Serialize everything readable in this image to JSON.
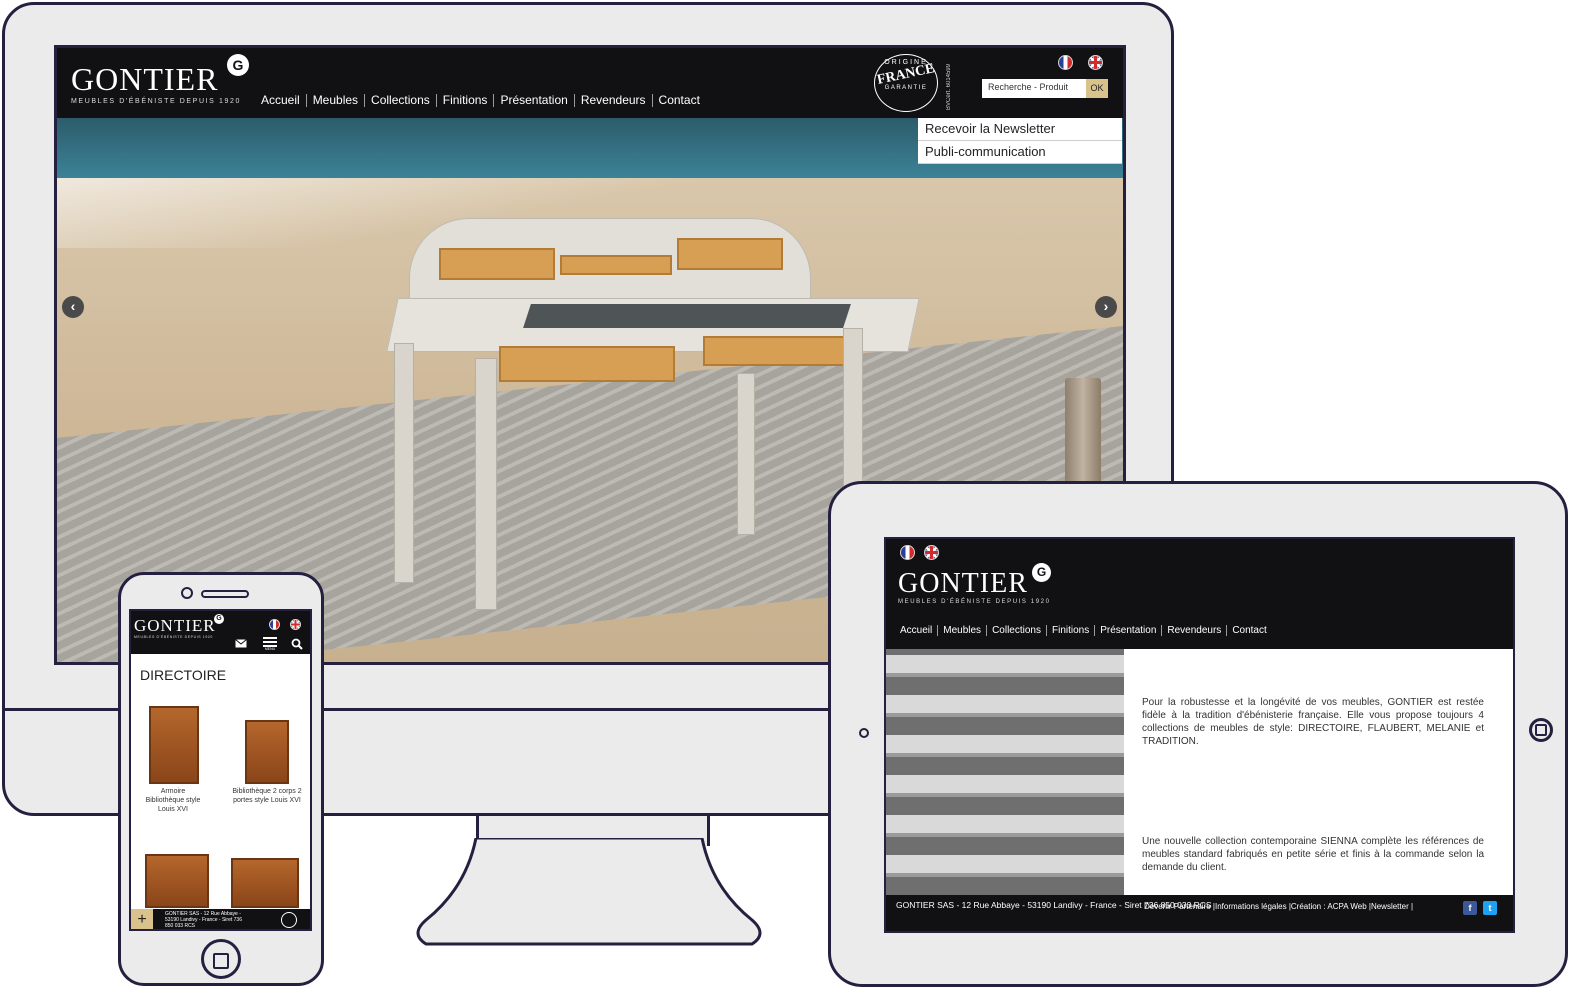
{
  "brand": {
    "name": "GONTIER",
    "badge": "G",
    "tagline": "MEUBLES D'ÉBÉNISTE DEPUIS 1920",
    "tagline_short": "MEUBLES D'ÉBÉNISTE DEPUIS 1920"
  },
  "nav": {
    "items": [
      "Accueil",
      "Meubles",
      "Collections",
      "Finitions",
      "Présentation",
      "Revendeurs",
      "Contact"
    ]
  },
  "seal": {
    "top": "ORIGINE",
    "main": "FRANCE",
    "bottom": "GARANTIE",
    "cert": "BVCert. 6014599"
  },
  "search": {
    "placeholder": "Recherche - Produit",
    "button": "OK"
  },
  "desktop": {
    "menu_links": [
      "Recevoir la Newsletter",
      "Publi-communication"
    ],
    "prev_arrow": "‹",
    "next_arrow": "›"
  },
  "tablet": {
    "paragraph1": "Pour la robustesse et la longévité de vos meubles, GONTIER est restée fidèle à la tradition d'ébénisterie française. Elle vous propose toujours 4 collections de meubles de style: DIRECTOIRE, FLAUBERT, MELANIE et TRADITION.",
    "paragraph2": "Une nouvelle collection contemporaine SIENNA complète les références de meubles standard fabriqués en petite série et finis à la commande selon la demande du client.",
    "footer_address": "GONTIER SAS - 12 Rue Abbaye - 53190 Landivy - France - Siret 736 850 033 RCS",
    "footer_links": "Devenir Partenaire |Informations légales |Création : ACPA Web |Newsletter |",
    "facebook": "f",
    "twitter": "t"
  },
  "phone": {
    "section_title": "DIRECTOIRE",
    "menu_label": "MENU",
    "products": [
      {
        "label": "Armoire Bibliothèque style Louis XVI"
      },
      {
        "label": "Bibliothèque 2 corps 2 portes style Louis XVI"
      }
    ],
    "footer_address": "GONTIER SAS - 12 Rue Abbaye - 53190 Landivy - France - Siret 736 850 033 RCS",
    "plus": "+"
  },
  "colors": {
    "frame": "#25203f",
    "device_body": "#ebebeb",
    "header_bg": "#111114",
    "accent": "#d9c28c"
  },
  "icons": [
    "flag-fr-icon",
    "flag-uk-icon",
    "mail-icon",
    "menu-icon",
    "search-icon",
    "arrow-left-icon",
    "arrow-right-icon",
    "facebook-icon",
    "twitter-icon",
    "plus-icon",
    "home-button-icon"
  ]
}
